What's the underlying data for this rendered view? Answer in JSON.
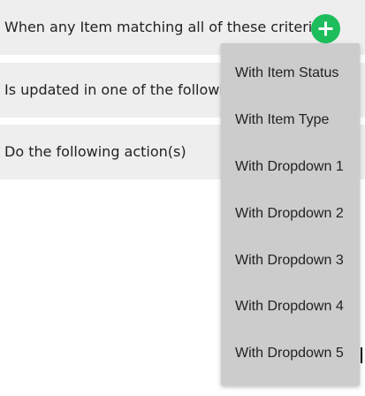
{
  "sections": [
    {
      "label": "When any Item matching all of these criteria"
    },
    {
      "label": "Is updated in one of the following ways"
    },
    {
      "label": "Do the following action(s)"
    }
  ],
  "add_button": {
    "icon": "plus-icon",
    "color": "#1dbd5b"
  },
  "dropdown": {
    "items": [
      {
        "label": "With Item Status"
      },
      {
        "label": "With Item Type"
      },
      {
        "label": "With Dropdown 1"
      },
      {
        "label": "With Dropdown 2"
      },
      {
        "label": "With Dropdown 3"
      },
      {
        "label": "With Dropdown 4"
      },
      {
        "label": "With Dropdown 5"
      }
    ]
  },
  "colors": {
    "section_bg": "#eeeeee",
    "dropdown_bg": "#cccccc",
    "accent": "#1dbd5b"
  }
}
